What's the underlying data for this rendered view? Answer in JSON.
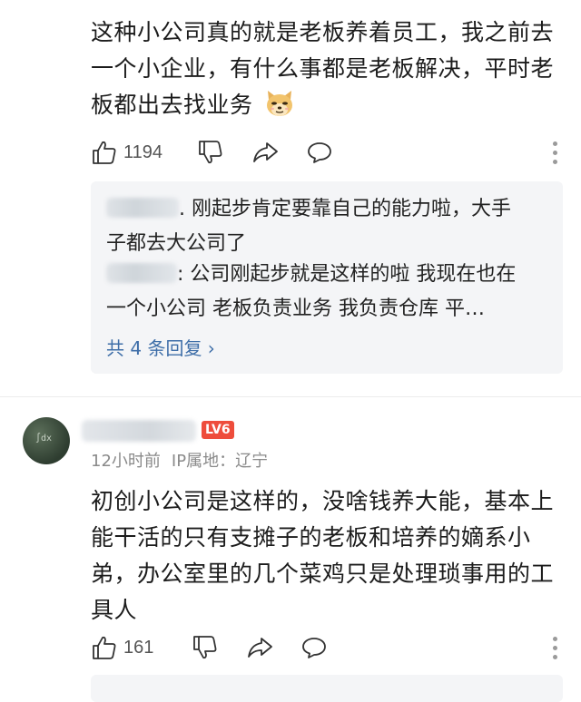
{
  "comment1": {
    "lines": [
      "这种小公司真的就是老板养着员工，我之前去",
      "一个小企业，有什么事都是老板解决，平时老",
      "板都出去找业务"
    ],
    "emoji": "doge-emoji",
    "like_count": "1194"
  },
  "replies": {
    "items": [
      {
        "line1": ". 刚起步肯定要靠自己的能力啦，大手",
        "line2": "子都去大公司了"
      },
      {
        "line1": ": 公司刚起步就是这样的啦  我现在也在",
        "line2": "一个小公司  老板负责业务    我负责仓库  平…"
      }
    ],
    "total_label": "共 4 条回复 ›"
  },
  "comment2": {
    "level_badge": "LV6",
    "time": "12小时前",
    "ip_label": "IP属地：辽宁",
    "lines": [
      "初创小公司是这样的，没啥钱养大能，基本上",
      "能干活的只有支摊子的老板和培养的嫡系小",
      "弟，办公室里的几个菜鸡只是处理琐事用的工",
      "具人"
    ],
    "like_count": "161"
  },
  "icons": [
    "thumb-up-icon",
    "thumb-down-icon",
    "share-icon",
    "comment-icon",
    "more-icon"
  ],
  "colors": {
    "link": "#3e6ea8",
    "badge": "#ee4d3c",
    "reply_bg": "#f4f5f7"
  }
}
